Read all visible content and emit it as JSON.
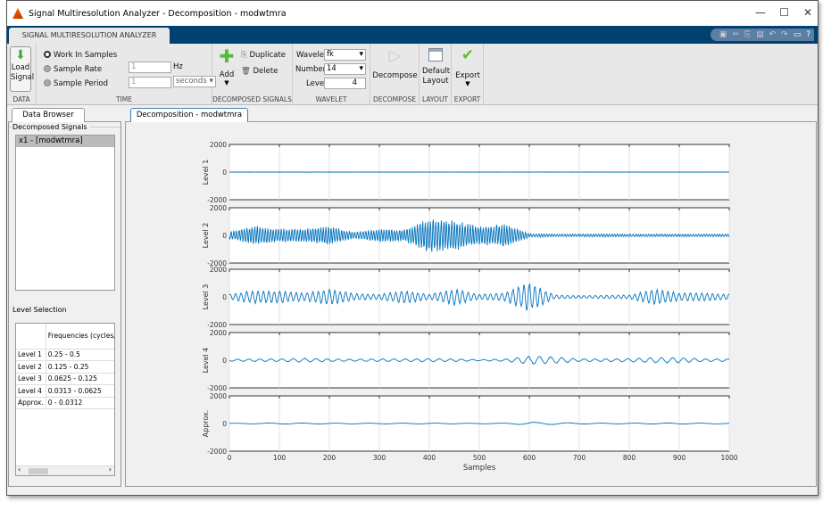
{
  "window": {
    "title": "Signal Multiresolution Analyzer - Decomposition - modwtmra",
    "minimize": "—",
    "maximize": "☐",
    "close": "✕"
  },
  "ribbon": {
    "tab": "SIGNAL MULTIRESOLUTION ANALYZER",
    "quick_access": [
      "save-icon",
      "cut-icon",
      "copy-icon",
      "paste-icon",
      "undo-icon",
      "redo-icon",
      "window-icon",
      "help-icon"
    ],
    "data": {
      "load": "Load Signal",
      "group": "DATA"
    },
    "time": {
      "work_in_samples": "Work In Samples",
      "sample_rate": "Sample Rate",
      "sample_rate_value": "1",
      "sample_rate_unit": "Hz",
      "sample_period": "Sample Period",
      "sample_period_value": "1",
      "sample_period_unit": "seconds",
      "group": "TIME",
      "selected": "Work In Samples"
    },
    "decomposed": {
      "add": "Add",
      "duplicate": "Duplicate",
      "delete": "Delete",
      "group": "DECOMPOSED SIGNALS"
    },
    "wavelet": {
      "wavelet_label": "Wavelet",
      "wavelet_value": "fk",
      "number_label": "Number",
      "number_value": "14",
      "level_label": "Level",
      "level_value": "4",
      "group": "WAVELET"
    },
    "decompose": {
      "label": "Decompose",
      "group": "DECOMPOSE"
    },
    "layout": {
      "label": "Default Layout",
      "group": "LAYOUT"
    },
    "export": {
      "label": "Export",
      "group": "EXPORT"
    }
  },
  "data_browser": {
    "tab": "Data Browser",
    "signals_title": "Decomposed  Signals",
    "signals": [
      "x1 - [modwtmra]"
    ],
    "level_selection": {
      "title": "Level Selection",
      "header": "Frequencies (cycles/sample)",
      "rows": [
        [
          "Level 1",
          "0.25 - 0.5"
        ],
        [
          "Level 2",
          "0.125 - 0.25"
        ],
        [
          "Level 3",
          "0.0625 - 0.125"
        ],
        [
          "Level 4",
          "0.0313 - 0.0625"
        ],
        [
          "Approx.",
          "0 - 0.0312"
        ]
      ]
    }
  },
  "doc_tab": "Decomposition - modwtmra",
  "chart_data": {
    "type": "line",
    "xlabel": "Samples",
    "xlim": [
      0,
      1000
    ],
    "xticks": [
      0,
      100,
      200,
      300,
      400,
      500,
      600,
      700,
      800,
      900,
      1000
    ],
    "ylim": [
      -2000,
      2000
    ],
    "yticks": [
      -2000,
      0,
      2000
    ],
    "grid": true,
    "color": "#0072bd",
    "envelope_x": [
      0,
      50,
      100,
      150,
      200,
      250,
      300,
      350,
      400,
      450,
      500,
      550,
      600,
      650,
      700,
      750,
      800,
      850,
      900,
      950,
      1000
    ],
    "series": [
      {
        "name": "Level 1",
        "cycles_per_sample": 0.35,
        "amplitude": [
          10,
          10,
          10,
          15,
          10,
          10,
          10,
          10,
          15,
          10,
          10,
          10,
          15,
          10,
          10,
          10,
          10,
          10,
          10,
          10,
          10
        ]
      },
      {
        "name": "Level 2",
        "cycles_per_sample": 0.19,
        "amplitude": [
          300,
          700,
          500,
          500,
          700,
          250,
          500,
          450,
          1300,
          1100,
          700,
          900,
          150,
          100,
          100,
          120,
          100,
          100,
          100,
          100,
          100
        ]
      },
      {
        "name": "Level 3",
        "cycles_per_sample": 0.09,
        "amplitude": [
          200,
          500,
          450,
          300,
          600,
          250,
          200,
          500,
          200,
          600,
          200,
          300,
          1100,
          150,
          100,
          120,
          150,
          600,
          300,
          300,
          200
        ]
      },
      {
        "name": "Level 4",
        "cycles_per_sample": 0.045,
        "amplitude": [
          80,
          100,
          100,
          150,
          100,
          80,
          100,
          100,
          120,
          100,
          50,
          80,
          300,
          250,
          100,
          100,
          120,
          200,
          200,
          100,
          100
        ]
      },
      {
        "name": "Approx.",
        "cycles_per_sample": 0.015,
        "amplitude": [
          20,
          30,
          40,
          40,
          30,
          30,
          30,
          30,
          30,
          30,
          20,
          30,
          100,
          80,
          40,
          30,
          30,
          40,
          40,
          30,
          30
        ]
      }
    ]
  }
}
